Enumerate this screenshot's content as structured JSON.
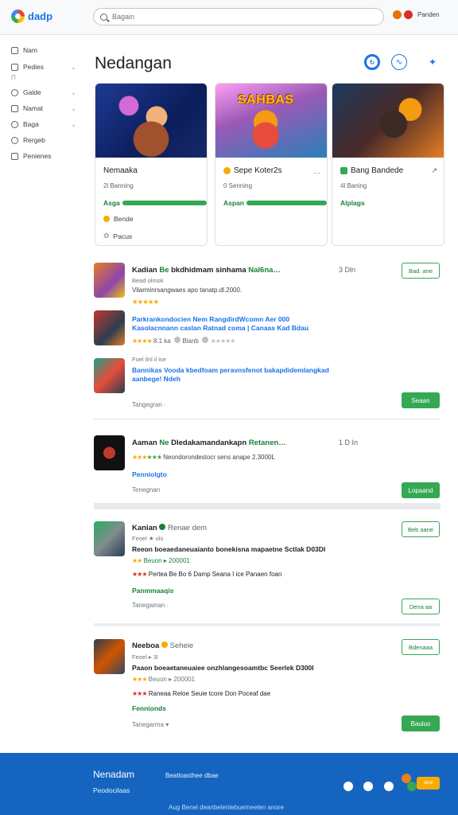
{
  "header": {
    "logo": "dadp",
    "search_placeholder": "Bagain",
    "user_label": "Panden"
  },
  "sidebar": {
    "items": [
      {
        "label": "Nam",
        "icon": "grid-icon"
      },
      {
        "label": "Pedies",
        "icon": "grid-icon"
      },
      {
        "label": "Galde",
        "icon": "circle-icon"
      },
      {
        "label": "Namat",
        "icon": "grid-icon"
      },
      {
        "label": "Baga",
        "icon": "circle-icon"
      },
      {
        "label": "Rergeb",
        "icon": "settings-icon"
      },
      {
        "label": "Penienes",
        "icon": "grid-icon"
      }
    ],
    "sub_marker": "П"
  },
  "main": {
    "title": "Nedangan",
    "actions": [
      "refresh-icon",
      "activity-icon",
      "sparkle-icon"
    ]
  },
  "cards": [
    {
      "image": "game-art-space-soldier",
      "name": "Nemaaka",
      "sub": "2l Banning",
      "status": "Asga",
      "progress": 1.0,
      "extra1": "Bende",
      "extra2": "Pacus"
    },
    {
      "image": "game-art-colorful-mascot",
      "image_title": "SAHBAS",
      "name": "Sepe Koter2s",
      "name_tail": "…",
      "sub": "0 Senning",
      "status": "Aspan",
      "progress": 1.0
    },
    {
      "image": "game-art-battle-fire",
      "name": "Bang Bandede",
      "name_tail": "↗",
      "sub": "4l Baning",
      "status": "Alplags"
    }
  ],
  "list": [
    {
      "button": "Bad. ane",
      "num": "3 Dln",
      "rows": [
        {
          "title_a": "Kadian",
          "title_b": "Be",
          "title_c": "bkdhidmam sinhama",
          "title_d": "Nal6na…",
          "meta": "Bead olmok",
          "desc": "Vilarminrsangwaes apo tanatp.dl.2000.",
          "stars": "★★★★★"
        },
        {
          "line1": "Parkrankondocien Nem RangdirdWcomn Aer 000",
          "line2": "Kasolacnnann caslan Ratnad coma | Canaas Kad Bdau",
          "stars": "★★★★",
          "rating": "8.1 ka",
          "tag1": "Blanb",
          "stars2": "★★★★★"
        },
        {
          "meta": "Foel ilnl il ise",
          "line1": "Bannikas Vooda kbedfoam peravnsfenot bakapdidemlangkad",
          "line2": "aanbege! Ndeh",
          "footer": "Tangegran ·"
        }
      ],
      "action": "Seaan"
    },
    {
      "button": "",
      "num": "1 D In",
      "title_a": "Aaman",
      "title_b": "Ne",
      "title_c": "Dledakamandankapn",
      "title_d": "Retanen…",
      "stars": "★★★",
      "stars_g": "★★★",
      "meta": "Neondorondestocr sens anape 2.3000L",
      "link": "Penniolgto",
      "footer": "Tenegnan",
      "action": "Lopaand"
    },
    {
      "button": "Beb aane",
      "title_a": "Kanian",
      "title_tail": "Renae dem",
      "meta": "Feoel ★ ols",
      "line1": "Reeon boeaedaneuaianto bonekisna mapaetne Sctlak D03DI",
      "stars": "★★",
      "meta2": "Beuon ▸ 200001",
      "row2": "Pertea Be Bo 6 Damp Seana I ice Panaen foan",
      "link": "Panmmaaqis",
      "footer": "Tanegainan ·",
      "action": "Dena aa"
    },
    {
      "button": "Bdenaaa",
      "title_a": "Neeboa",
      "title_tail": "Seheie",
      "meta": "Feoel ▸ 3l",
      "line1": "Paaon boeaetaneuaiee onzhlangesoamtbc Seerlek D300I",
      "stars": "★★★",
      "meta2": "Beuon ▸ 200001",
      "row2": "Raneaa Reloe Seuie tcore Don Poceaf dae",
      "link": "Fennionds",
      "footer": "Tanegarma ▾",
      "action": "Bauluo"
    }
  ],
  "footer": {
    "title": "Nenadam",
    "sub": "Peodocilaas",
    "mid": "Beatloasthee dbae",
    "bottom": "Aug Benel deanbelenlebue/neelen anore",
    "badge": "NEW"
  }
}
